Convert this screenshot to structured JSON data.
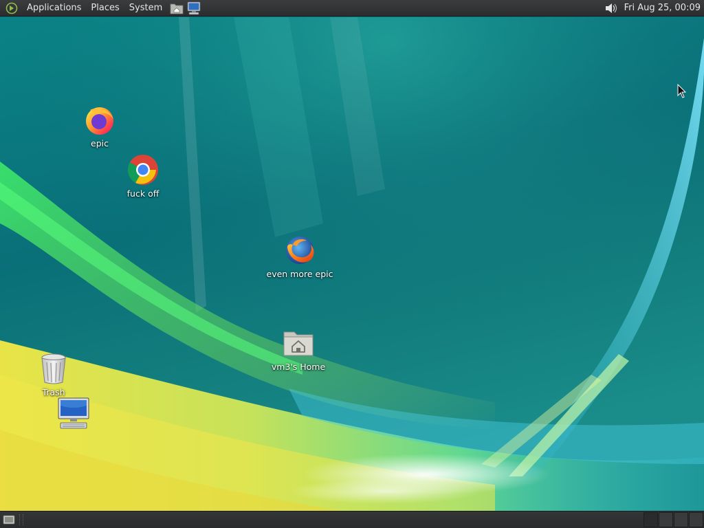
{
  "top_panel": {
    "menus": {
      "applications": "Applications",
      "places": "Places",
      "system": "System"
    },
    "launchers": [
      {
        "icon": "home-folder-icon"
      },
      {
        "icon": "computer-icon"
      }
    ],
    "volume_icon": "speaker-icon",
    "clock": "Fri Aug 25, 00:09"
  },
  "desktop": {
    "wallpaper": "windows-vista-aurora",
    "icons": [
      {
        "label": "epic",
        "icon": "firefox-icon"
      },
      {
        "label": "fuck off",
        "icon": "chrome-icon"
      },
      {
        "label": "even more epic",
        "icon": "firefox-classic-icon"
      },
      {
        "label": "vm3's Home",
        "icon": "home-folder-icon"
      },
      {
        "label": "Trash",
        "icon": "trash-icon"
      },
      {
        "label": "",
        "icon": "computer-icon"
      }
    ]
  },
  "bottom_panel": {
    "show_desktop_icon": "show-desktop-icon",
    "workspaces": 4,
    "active_workspace": 1
  },
  "colors": {
    "panel": "#2e2f31",
    "panel_text": "#e6e6e6",
    "wallpaper_teal": "#0b6f7a",
    "wallpaper_green": "#4fd64a",
    "wallpaper_yellow": "#e9e34a"
  }
}
